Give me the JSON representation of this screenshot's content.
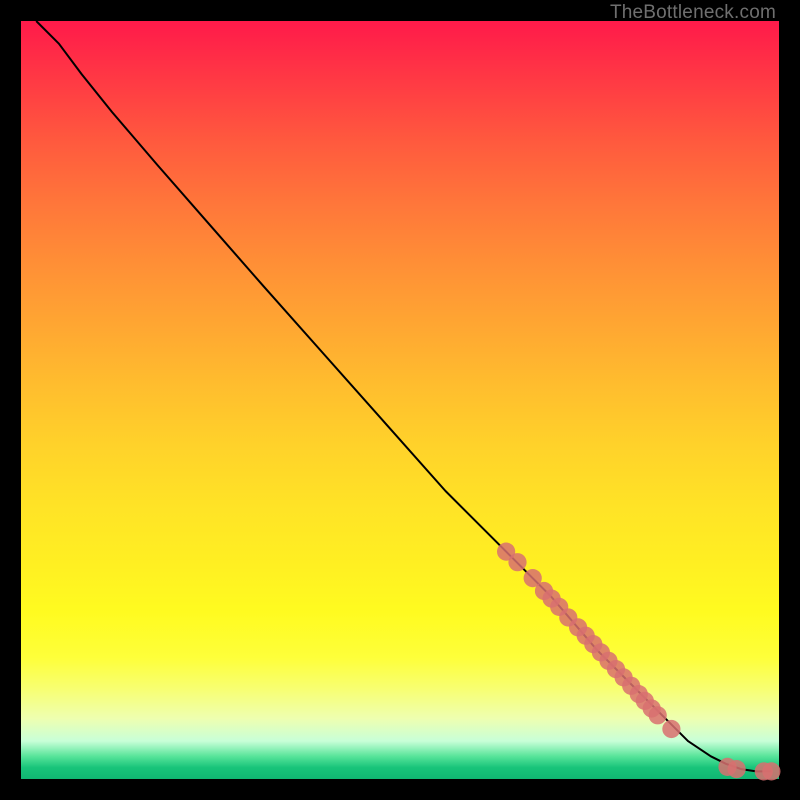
{
  "watermark": "TheBottleneck.com",
  "chart_data": {
    "type": "line",
    "title": "",
    "xlabel": "",
    "ylabel": "",
    "xlim": [
      0,
      100
    ],
    "ylim": [
      0,
      100
    ],
    "grid": false,
    "legend": false,
    "series": [
      {
        "name": "curve",
        "type": "line",
        "color": "#000000",
        "x": [
          2,
          5,
          8,
          12,
          18,
          25,
          32,
          40,
          48,
          56,
          64,
          70,
          76,
          80,
          84,
          88,
          91,
          93,
          95,
          97,
          99
        ],
        "y": [
          100,
          97,
          93,
          88,
          81,
          73,
          65,
          56,
          47,
          38,
          30,
          24,
          17,
          13,
          9,
          5,
          3,
          2,
          1.3,
          1,
          1
        ]
      },
      {
        "name": "marker-cluster",
        "type": "scatter",
        "color": "#d87070",
        "radius_axis_units": 1.2,
        "points": [
          {
            "x": 64.0,
            "y": 30.0
          },
          {
            "x": 65.5,
            "y": 28.6
          },
          {
            "x": 67.5,
            "y": 26.5
          },
          {
            "x": 69.0,
            "y": 24.8
          },
          {
            "x": 70.0,
            "y": 23.8
          },
          {
            "x": 71.0,
            "y": 22.7
          },
          {
            "x": 72.2,
            "y": 21.3
          },
          {
            "x": 73.5,
            "y": 20.0
          },
          {
            "x": 74.5,
            "y": 18.9
          },
          {
            "x": 75.5,
            "y": 17.8
          },
          {
            "x": 76.5,
            "y": 16.7
          },
          {
            "x": 77.5,
            "y": 15.6
          },
          {
            "x": 78.5,
            "y": 14.5
          },
          {
            "x": 79.5,
            "y": 13.4
          },
          {
            "x": 80.5,
            "y": 12.3
          },
          {
            "x": 81.5,
            "y": 11.2
          },
          {
            "x": 82.3,
            "y": 10.3
          },
          {
            "x": 83.2,
            "y": 9.3
          },
          {
            "x": 84.0,
            "y": 8.4
          },
          {
            "x": 85.8,
            "y": 6.6
          },
          {
            "x": 93.2,
            "y": 1.6
          },
          {
            "x": 94.4,
            "y": 1.3
          },
          {
            "x": 98.0,
            "y": 1.0
          },
          {
            "x": 99.0,
            "y": 1.0
          }
        ]
      }
    ]
  }
}
